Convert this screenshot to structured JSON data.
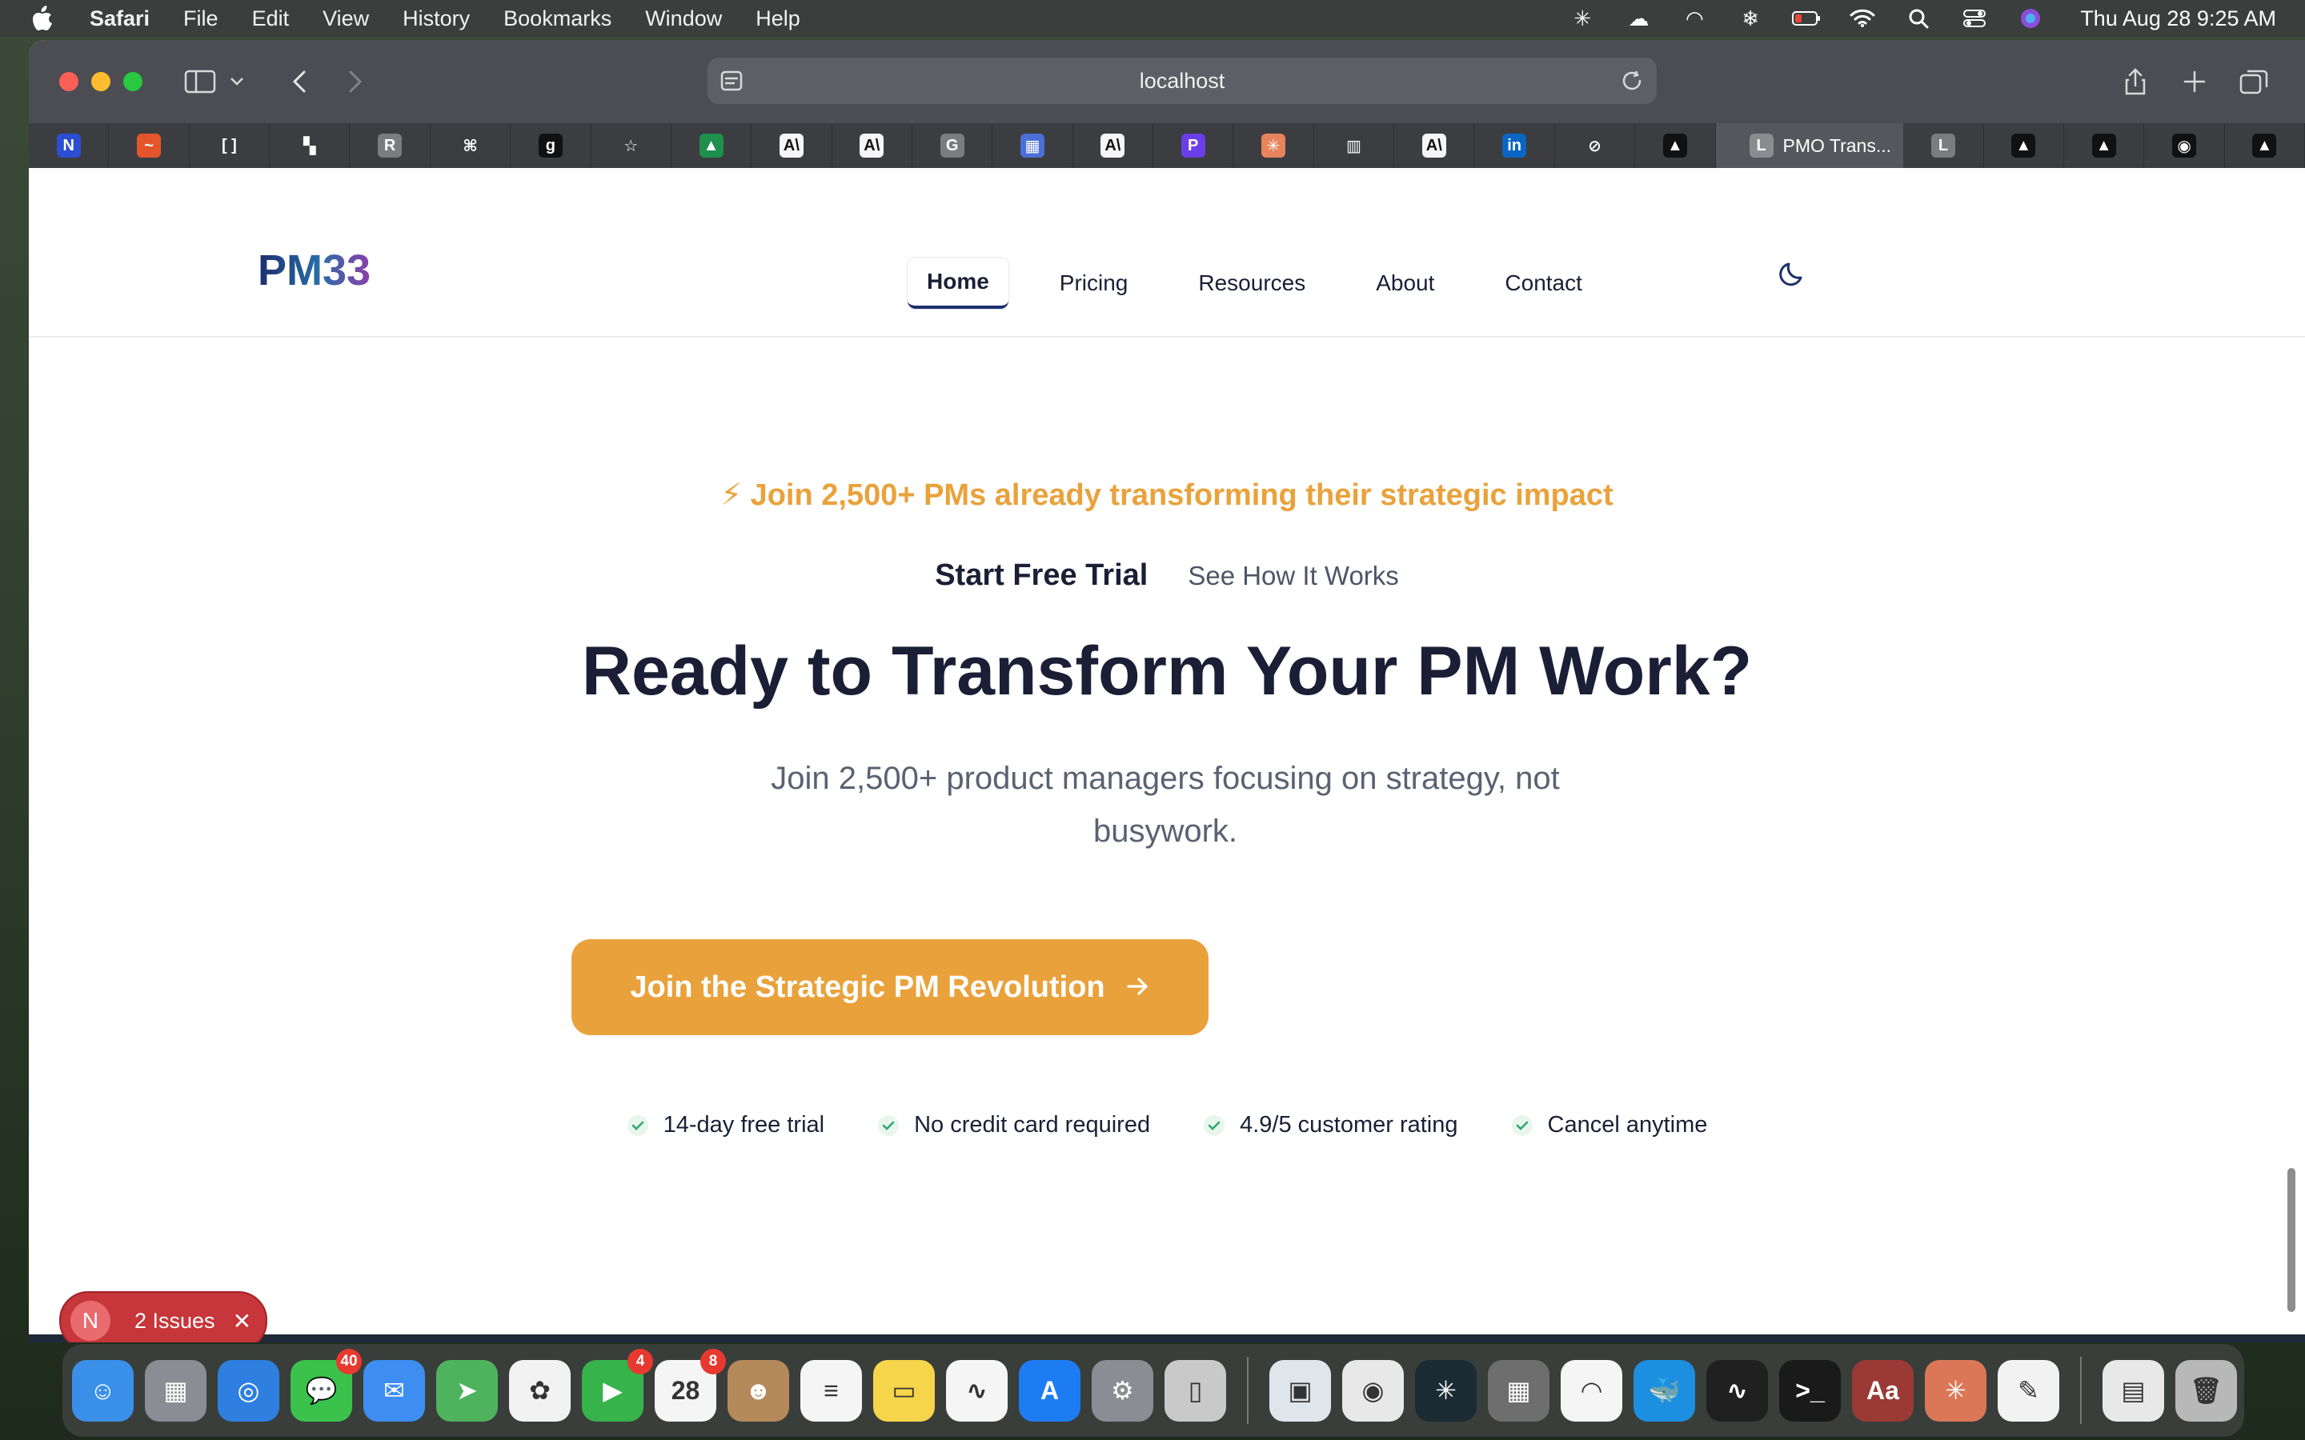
{
  "menubar": {
    "app": "Safari",
    "items": [
      "File",
      "Edit",
      "View",
      "History",
      "Bookmarks",
      "Window",
      "Help"
    ],
    "clock": "Thu Aug 28  9:25 AM"
  },
  "browser": {
    "address": "localhost",
    "active_tab": {
      "initial": "L",
      "title": "PMO Trans..."
    },
    "pinned_tabs": [
      {
        "glyph": "N",
        "color": "#2d4dd3"
      },
      {
        "glyph": "~",
        "color": "#e4552b"
      },
      {
        "glyph": "[ ]",
        "color": "#3b3d41"
      },
      {
        "glyph": "▚",
        "color": "#3b3d41"
      },
      {
        "glyph": "R",
        "color": "#7a7c80"
      },
      {
        "glyph": "⌘",
        "color": "#3b3d41"
      },
      {
        "glyph": "g",
        "color": "#111111"
      },
      {
        "glyph": "☆",
        "color": "#3b3d41"
      },
      {
        "glyph": "▲",
        "color": "#1f8f4d"
      },
      {
        "glyph": "A\\",
        "color": "#f5f5f5"
      },
      {
        "glyph": "A\\",
        "color": "#f5f5f5"
      },
      {
        "glyph": "G",
        "color": "#7a7c80"
      },
      {
        "glyph": "▦",
        "color": "#4a6fd6"
      },
      {
        "glyph": "A\\",
        "color": "#f5f5f5"
      },
      {
        "glyph": "P",
        "color": "#6b3ee8"
      },
      {
        "glyph": "✳",
        "color": "#e8845c"
      },
      {
        "glyph": "▥",
        "color": "#3b3d41"
      },
      {
        "glyph": "A\\",
        "color": "#f5f5f5"
      },
      {
        "glyph": "in",
        "color": "#0a66c2"
      },
      {
        "glyph": "⊘",
        "color": "#3b3d41"
      },
      {
        "glyph": "▲",
        "color": "#111111"
      }
    ],
    "trailing_tabs": [
      {
        "glyph": "L",
        "color": "#7a7c80"
      },
      {
        "glyph": "▲",
        "color": "#111111"
      },
      {
        "glyph": "▲",
        "color": "#111111"
      },
      {
        "glyph": "◉",
        "color": "#111111"
      },
      {
        "glyph": "▲",
        "color": "#111111"
      }
    ]
  },
  "site": {
    "logo_text": "PM33",
    "nav": [
      "Home",
      "Pricing",
      "Resources",
      "About",
      "Contact"
    ],
    "active_nav": "Home",
    "promo": "⚡ Join 2,500+ PMs already transforming their strategic impact",
    "cta_primary": "Start Free Trial",
    "cta_secondary": "See How It Works",
    "headline": "Ready to Transform Your PM Work?",
    "subhead": "Join 2,500+ product managers focusing on strategy, not busywork.",
    "big_cta": "Join the Strategic PM Revolution",
    "features": [
      "14-day free trial",
      "No credit card required",
      "4.9/5 customer rating",
      "Cancel anytime"
    ]
  },
  "issues": {
    "initial": "N",
    "label": "2 Issues"
  },
  "dock": {
    "apps": [
      {
        "name": "finder",
        "color": "#3a8fe8",
        "glyph": "☺"
      },
      {
        "name": "launchpad",
        "color": "#8a8e94",
        "glyph": "▦"
      },
      {
        "name": "safari",
        "color": "#2f7fe0",
        "glyph": "◎"
      },
      {
        "name": "messages",
        "color": "#3ac24d",
        "glyph": "💬",
        "badge": "40"
      },
      {
        "name": "mail",
        "color": "#3d8ef0",
        "glyph": "✉"
      },
      {
        "name": "maps",
        "color": "#4fb35d",
        "glyph": "➤"
      },
      {
        "name": "photos",
        "color": "#f2f2f2",
        "glyph": "✿"
      },
      {
        "name": "facetime",
        "color": "#36b34a",
        "glyph": "▶",
        "badge": "4"
      },
      {
        "name": "calendar",
        "color": "#f5f5f5",
        "glyph": "28",
        "badge": "8"
      },
      {
        "name": "contacts",
        "color": "#b48a5b",
        "glyph": "☻"
      },
      {
        "name": "reminders",
        "color": "#f5f5f5",
        "glyph": "≡"
      },
      {
        "name": "notes",
        "color": "#f6d54a",
        "glyph": "▭"
      },
      {
        "name": "freeform",
        "color": "#f5f5f5",
        "glyph": "∿"
      },
      {
        "name": "app-store",
        "color": "#1e7cf2",
        "glyph": "A"
      },
      {
        "name": "system-settings",
        "color": "#8a8e94",
        "glyph": "⚙"
      },
      {
        "name": "iphone-mirroring",
        "color": "#c9c9c9",
        "glyph": "▯"
      }
    ],
    "apps_right": [
      {
        "name": "preview",
        "color": "#dfe5ea",
        "glyph": "▣"
      },
      {
        "name": "chrome",
        "color": "#e8e8e8",
        "glyph": "◉"
      },
      {
        "name": "perplexity",
        "color": "#1b2b33",
        "glyph": "✳"
      },
      {
        "name": "calculator",
        "color": "#6e6e6e",
        "glyph": "▦"
      },
      {
        "name": "nordvpn",
        "color": "#f5f5f5",
        "glyph": "◠"
      },
      {
        "name": "docker",
        "color": "#1d8fe0",
        "glyph": "🐳"
      },
      {
        "name": "activity-monitor",
        "color": "#202020",
        "glyph": "∿"
      },
      {
        "name": "terminal",
        "color": "#1a1a1a",
        "glyph": ">_"
      },
      {
        "name": "dictionary",
        "color": "#9b3a34",
        "glyph": "Aa"
      },
      {
        "name": "claude",
        "color": "#d97757",
        "glyph": "✳"
      },
      {
        "name": "textedit",
        "color": "#f2f2f2",
        "glyph": "✎"
      }
    ],
    "apps_end": [
      {
        "name": "documents",
        "color": "#e8e8e8",
        "glyph": "▤"
      },
      {
        "name": "trash",
        "color": "#b8b8b8",
        "glyph": "🗑"
      }
    ]
  }
}
